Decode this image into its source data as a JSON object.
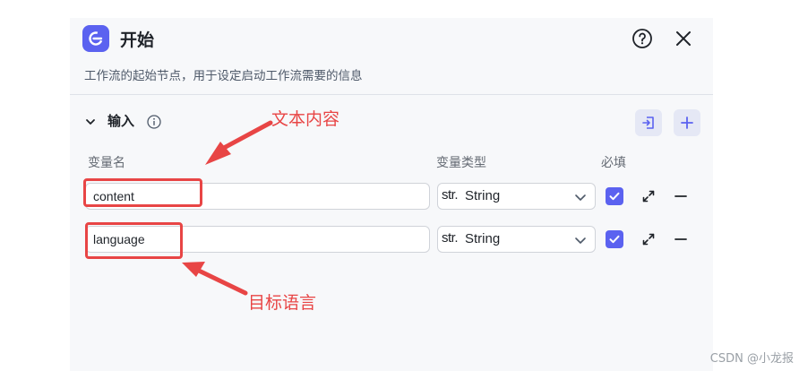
{
  "header": {
    "title": "开始",
    "description": "工作流的起始节点，用于设定启动工作流需要的信息",
    "help_icon": "help-circle-icon",
    "close_icon": "close-icon"
  },
  "input_section": {
    "title": "输入",
    "info_icon": "info-icon",
    "columns": {
      "name": "变量名",
      "type": "变量类型",
      "required": "必填"
    },
    "rows": [
      {
        "name": "content",
        "type_prefix": "str.",
        "type": "String",
        "required": true
      },
      {
        "name": "language",
        "type_prefix": "str.",
        "type": "String",
        "required": true
      }
    ]
  },
  "annotations": {
    "top_label": "文本内容",
    "bottom_label": "目标语言"
  },
  "watermark": "CSDN @小龙报",
  "colors": {
    "accent": "#5b62f0",
    "annotation": "#e84545",
    "panel_bg": "#f7f8fa"
  }
}
